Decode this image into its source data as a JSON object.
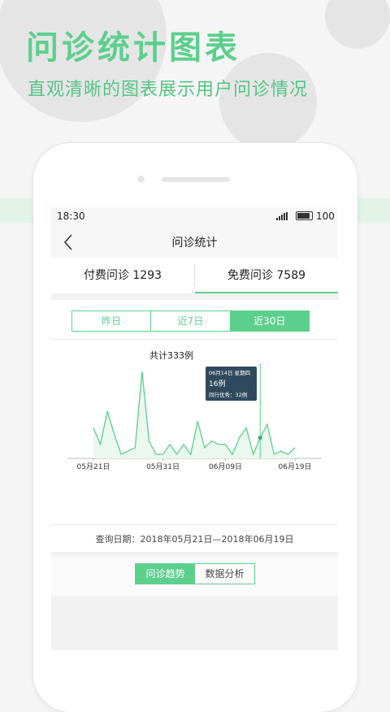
{
  "promo": {
    "title": "问诊统计图表",
    "subtitle": "直观清晰的图表展示用户问诊情况"
  },
  "status_bar": {
    "time": "18:30",
    "battery": "100"
  },
  "nav": {
    "back_icon": "chevron-left-icon",
    "title": "问诊统计"
  },
  "segments": [
    {
      "label": "付费问诊 1293",
      "selected": false
    },
    {
      "label": "免费问诊 7589",
      "selected": true
    }
  ],
  "ranges": [
    {
      "label": "昨日",
      "active": false
    },
    {
      "label": "近7日",
      "active": false
    },
    {
      "label": "近30日",
      "active": true
    }
  ],
  "chart_data": {
    "type": "area",
    "title": "共计333例",
    "x_ticks": [
      "05月21日",
      "05月31日",
      "06月09日",
      "06月19日"
    ],
    "values": [
      8,
      3,
      13,
      6,
      0,
      1,
      2,
      25,
      4,
      0,
      0,
      3,
      0,
      3,
      0,
      10,
      2,
      4,
      3,
      3,
      0,
      5,
      8,
      0,
      5,
      9,
      0,
      1,
      0,
      2
    ],
    "selected_index": 24,
    "tooltip": {
      "date": "06月14日 星期四",
      "value": "16例",
      "note": "同行优秀：32例"
    },
    "accent": "#5ccf8d",
    "tooltip_bg": "#2f4a5e"
  },
  "query": {
    "text": "查询日期：2018年05月21日—2018年06月19日"
  },
  "bottom_tabs": [
    {
      "label": "问诊趋势",
      "active": true
    },
    {
      "label": "数据分析",
      "active": false
    }
  ],
  "colors": {
    "brand_green": "#5ccf8d"
  }
}
